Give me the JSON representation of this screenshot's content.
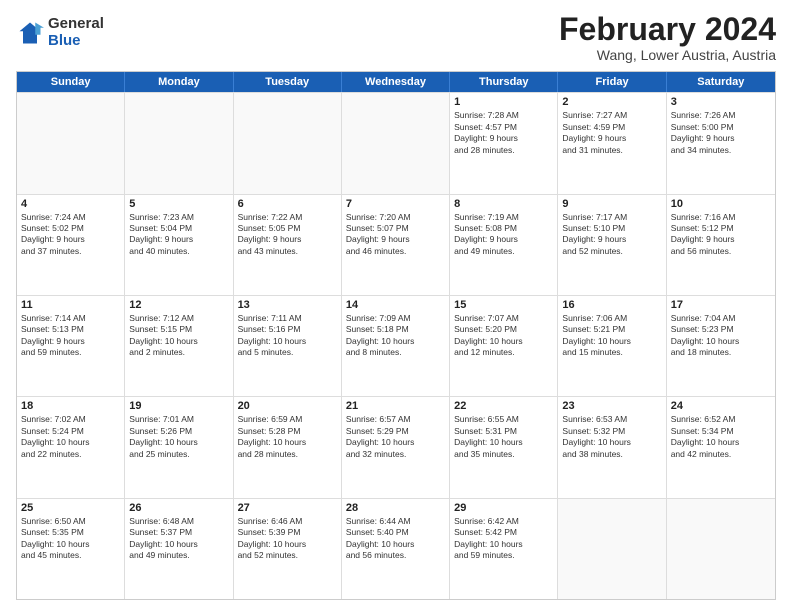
{
  "logo": {
    "general": "General",
    "blue": "Blue"
  },
  "title": "February 2024",
  "location": "Wang, Lower Austria, Austria",
  "days": [
    "Sunday",
    "Monday",
    "Tuesday",
    "Wednesday",
    "Thursday",
    "Friday",
    "Saturday"
  ],
  "rows": [
    [
      {
        "day": "",
        "text": "",
        "empty": true
      },
      {
        "day": "",
        "text": "",
        "empty": true
      },
      {
        "day": "",
        "text": "",
        "empty": true
      },
      {
        "day": "",
        "text": "",
        "empty": true
      },
      {
        "day": "1",
        "text": "Sunrise: 7:28 AM\nSunset: 4:57 PM\nDaylight: 9 hours\nand 28 minutes."
      },
      {
        "day": "2",
        "text": "Sunrise: 7:27 AM\nSunset: 4:59 PM\nDaylight: 9 hours\nand 31 minutes."
      },
      {
        "day": "3",
        "text": "Sunrise: 7:26 AM\nSunset: 5:00 PM\nDaylight: 9 hours\nand 34 minutes."
      }
    ],
    [
      {
        "day": "4",
        "text": "Sunrise: 7:24 AM\nSunset: 5:02 PM\nDaylight: 9 hours\nand 37 minutes."
      },
      {
        "day": "5",
        "text": "Sunrise: 7:23 AM\nSunset: 5:04 PM\nDaylight: 9 hours\nand 40 minutes."
      },
      {
        "day": "6",
        "text": "Sunrise: 7:22 AM\nSunset: 5:05 PM\nDaylight: 9 hours\nand 43 minutes."
      },
      {
        "day": "7",
        "text": "Sunrise: 7:20 AM\nSunset: 5:07 PM\nDaylight: 9 hours\nand 46 minutes."
      },
      {
        "day": "8",
        "text": "Sunrise: 7:19 AM\nSunset: 5:08 PM\nDaylight: 9 hours\nand 49 minutes."
      },
      {
        "day": "9",
        "text": "Sunrise: 7:17 AM\nSunset: 5:10 PM\nDaylight: 9 hours\nand 52 minutes."
      },
      {
        "day": "10",
        "text": "Sunrise: 7:16 AM\nSunset: 5:12 PM\nDaylight: 9 hours\nand 56 minutes."
      }
    ],
    [
      {
        "day": "11",
        "text": "Sunrise: 7:14 AM\nSunset: 5:13 PM\nDaylight: 9 hours\nand 59 minutes."
      },
      {
        "day": "12",
        "text": "Sunrise: 7:12 AM\nSunset: 5:15 PM\nDaylight: 10 hours\nand 2 minutes."
      },
      {
        "day": "13",
        "text": "Sunrise: 7:11 AM\nSunset: 5:16 PM\nDaylight: 10 hours\nand 5 minutes."
      },
      {
        "day": "14",
        "text": "Sunrise: 7:09 AM\nSunset: 5:18 PM\nDaylight: 10 hours\nand 8 minutes."
      },
      {
        "day": "15",
        "text": "Sunrise: 7:07 AM\nSunset: 5:20 PM\nDaylight: 10 hours\nand 12 minutes."
      },
      {
        "day": "16",
        "text": "Sunrise: 7:06 AM\nSunset: 5:21 PM\nDaylight: 10 hours\nand 15 minutes."
      },
      {
        "day": "17",
        "text": "Sunrise: 7:04 AM\nSunset: 5:23 PM\nDaylight: 10 hours\nand 18 minutes."
      }
    ],
    [
      {
        "day": "18",
        "text": "Sunrise: 7:02 AM\nSunset: 5:24 PM\nDaylight: 10 hours\nand 22 minutes."
      },
      {
        "day": "19",
        "text": "Sunrise: 7:01 AM\nSunset: 5:26 PM\nDaylight: 10 hours\nand 25 minutes."
      },
      {
        "day": "20",
        "text": "Sunrise: 6:59 AM\nSunset: 5:28 PM\nDaylight: 10 hours\nand 28 minutes."
      },
      {
        "day": "21",
        "text": "Sunrise: 6:57 AM\nSunset: 5:29 PM\nDaylight: 10 hours\nand 32 minutes."
      },
      {
        "day": "22",
        "text": "Sunrise: 6:55 AM\nSunset: 5:31 PM\nDaylight: 10 hours\nand 35 minutes."
      },
      {
        "day": "23",
        "text": "Sunrise: 6:53 AM\nSunset: 5:32 PM\nDaylight: 10 hours\nand 38 minutes."
      },
      {
        "day": "24",
        "text": "Sunrise: 6:52 AM\nSunset: 5:34 PM\nDaylight: 10 hours\nand 42 minutes."
      }
    ],
    [
      {
        "day": "25",
        "text": "Sunrise: 6:50 AM\nSunset: 5:35 PM\nDaylight: 10 hours\nand 45 minutes."
      },
      {
        "day": "26",
        "text": "Sunrise: 6:48 AM\nSunset: 5:37 PM\nDaylight: 10 hours\nand 49 minutes."
      },
      {
        "day": "27",
        "text": "Sunrise: 6:46 AM\nSunset: 5:39 PM\nDaylight: 10 hours\nand 52 minutes."
      },
      {
        "day": "28",
        "text": "Sunrise: 6:44 AM\nSunset: 5:40 PM\nDaylight: 10 hours\nand 56 minutes."
      },
      {
        "day": "29",
        "text": "Sunrise: 6:42 AM\nSunset: 5:42 PM\nDaylight: 10 hours\nand 59 minutes."
      },
      {
        "day": "",
        "text": "",
        "empty": true
      },
      {
        "day": "",
        "text": "",
        "empty": true
      }
    ]
  ]
}
